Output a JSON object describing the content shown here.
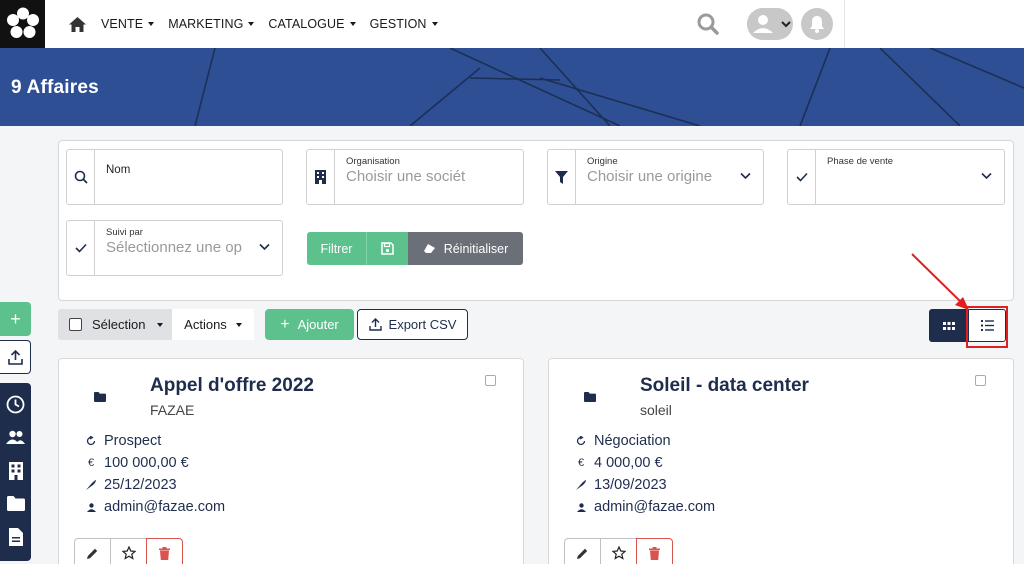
{
  "nav": {
    "items": [
      {
        "label": "VENTE"
      },
      {
        "label": "MARKETING"
      },
      {
        "label": "CATALOGUE"
      },
      {
        "label": "GESTION"
      }
    ]
  },
  "page": {
    "title": "9 Affaires"
  },
  "filters": {
    "nom": {
      "label": "Nom"
    },
    "organisation": {
      "label": "Organisation",
      "placeholder": "Choisir une sociét"
    },
    "origine": {
      "label": "Origine",
      "placeholder": "Choisir une origine"
    },
    "phase": {
      "label": "Phase de vente"
    },
    "suivi": {
      "label": "Suivi par",
      "placeholder": "Sélectionnez une op"
    }
  },
  "filter_buttons": {
    "filter": "Filtrer",
    "reset": "Réinitialiser"
  },
  "toolbar": {
    "selection": "Sélection",
    "actions": "Actions",
    "add": "Ajouter",
    "export": "Export CSV"
  },
  "colors": {
    "primary": "#1f2d4d",
    "success": "#5cc18c",
    "banner": "#2e4f94",
    "danger": "#d9534f",
    "highlight": "#e02020"
  },
  "cards": [
    {
      "title": "Appel d'offre 2022",
      "org": "FAZAE",
      "phase": "Prospect",
      "amount": "100 000,00 €",
      "date": "25/12/2023",
      "user": "admin@fazae.com"
    },
    {
      "title": "Soleil - data center",
      "org": "soleil",
      "phase": "Négociation",
      "amount": "4 000,00 €",
      "date": "13/09/2023",
      "user": "admin@fazae.com"
    }
  ],
  "icons": {
    "currency": "€"
  }
}
